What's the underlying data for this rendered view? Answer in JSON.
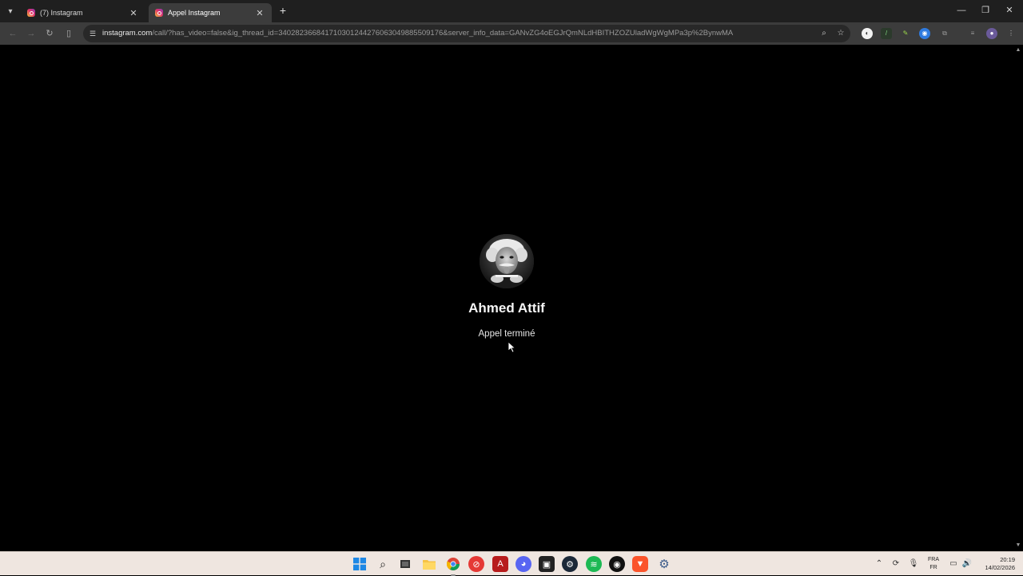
{
  "tabs": [
    {
      "title": "(7) Instagram",
      "active": false
    },
    {
      "title": "Appel Instagram",
      "active": true
    }
  ],
  "address_bar": {
    "host": "instagram.com",
    "path": "/call/?has_video=false&ig_thread_id=340282366841710301244276063049885509176&server_info_data=GANvZG4oEGJrQmNLdHBITHZOZUladWgWgMPa3p%2BynwMA"
  },
  "call": {
    "callee_name": "Ahmed Attif",
    "status": "Appel terminé"
  },
  "taskbar": {
    "apps": [
      "windows-start",
      "search",
      "task-view",
      "file-explorer",
      "chrome",
      "app-red",
      "acrobat",
      "discord",
      "app-dark",
      "steam",
      "spotify",
      "app-black",
      "brave",
      "settings"
    ]
  },
  "system_tray": {
    "language_line1": "FRA",
    "language_line2": "FR",
    "time": "20:19",
    "date": "14/02/2026"
  },
  "colors": {
    "page_background": "#000000",
    "tab_strip": "#1f1f1f",
    "toolbar": "#3c3c3c",
    "taskbar": "#efe6e0"
  }
}
